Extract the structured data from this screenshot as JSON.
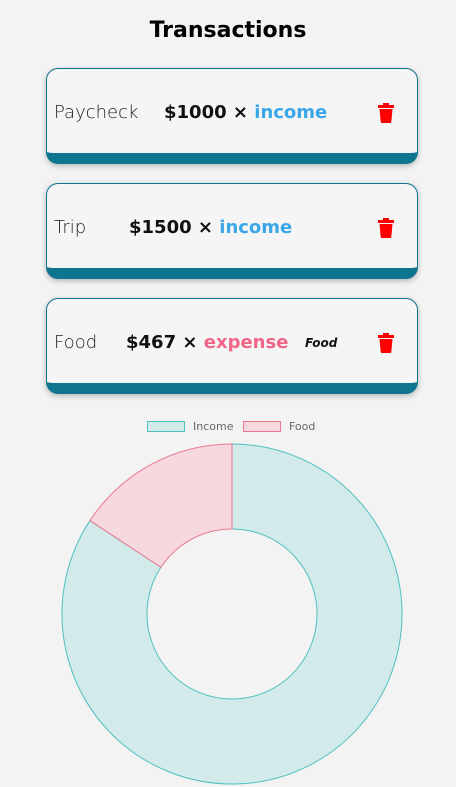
{
  "header": {
    "title": "Transactions"
  },
  "transactions": [
    {
      "name": "Paycheck",
      "amount": "$1000",
      "times": "×",
      "type": "income",
      "category": "",
      "delete_label": "trash-icon"
    },
    {
      "name": "Trip",
      "amount": "$1500",
      "times": "×",
      "type": "income",
      "category": "",
      "delete_label": "trash-icon"
    },
    {
      "name": "Food",
      "amount": "$467",
      "times": "×",
      "type": "expense",
      "category": "Food",
      "delete_label": "trash-icon"
    }
  ],
  "colors": {
    "income": "#3ba6e8",
    "expense": "#f06688",
    "card_border": "#0e7490",
    "delete": "#ff0000"
  },
  "chart_data": {
    "type": "pie",
    "style": "doughnut",
    "legend_position": "top",
    "series": [
      {
        "name": "Income",
        "value": 2500,
        "fill": "#d3eaea",
        "stroke": "#4fc0c0"
      },
      {
        "name": "Food",
        "value": 467,
        "fill": "#f6d8de",
        "stroke": "#e87890"
      }
    ]
  }
}
